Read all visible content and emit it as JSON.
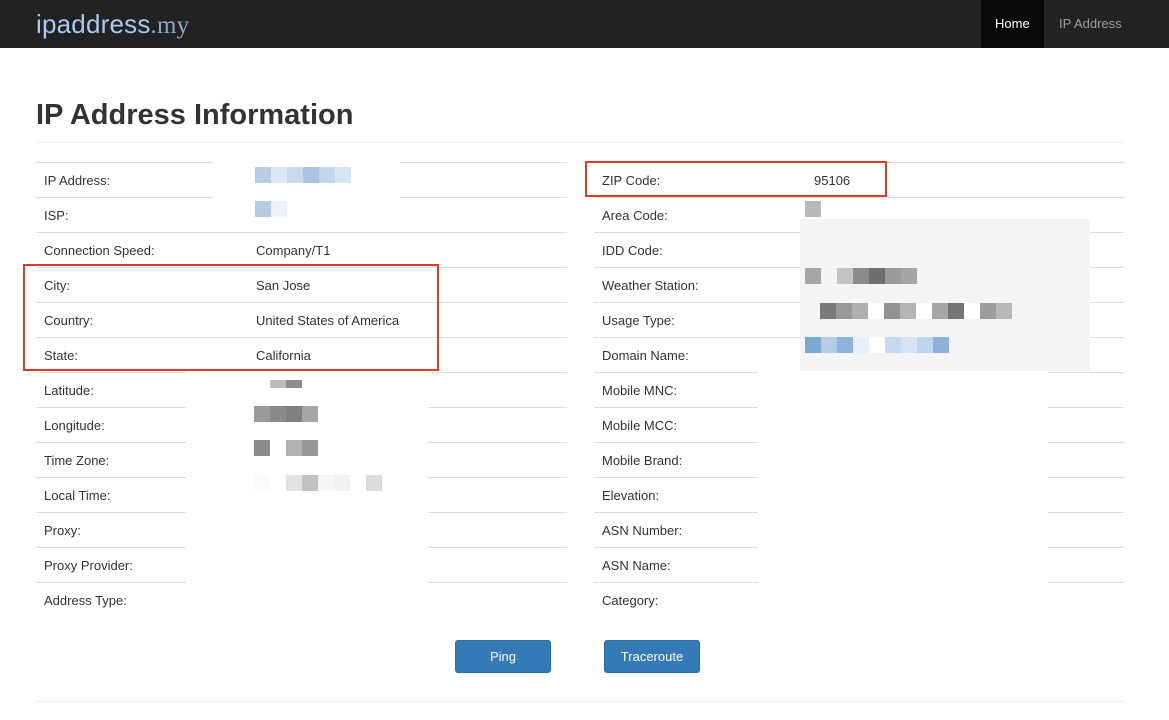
{
  "navbar": {
    "brand_name": "ipaddress",
    "brand_tld": ".my",
    "items": [
      {
        "label": "Home",
        "active": true
      },
      {
        "label": "IP Address",
        "active": false
      }
    ]
  },
  "page": {
    "title": "IP Address Information"
  },
  "left_table": [
    {
      "label": "IP Address:",
      "value": ""
    },
    {
      "label": "ISP:",
      "value": ""
    },
    {
      "label": "Connection Speed:",
      "value": "Company/T1"
    },
    {
      "label": "City:",
      "value": "San Jose"
    },
    {
      "label": "Country:",
      "value": "United States of America"
    },
    {
      "label": "State:",
      "value": "California"
    },
    {
      "label": "Latitude:",
      "value": ""
    },
    {
      "label": "Longitude:",
      "value": ""
    },
    {
      "label": "Time Zone:",
      "value": ""
    },
    {
      "label": "Local Time:",
      "value": ""
    },
    {
      "label": "Proxy:",
      "value": ""
    },
    {
      "label": "Proxy Provider:",
      "value": ""
    },
    {
      "label": "Address Type:",
      "value": ""
    }
  ],
  "right_table": [
    {
      "label": "ZIP Code:",
      "value": "95106"
    },
    {
      "label": "Area Code:",
      "value": ""
    },
    {
      "label": "IDD Code:",
      "value": ""
    },
    {
      "label": "Weather Station:",
      "value": ""
    },
    {
      "label": "Usage Type:",
      "value": ""
    },
    {
      "label": "Domain Name:",
      "value": ""
    },
    {
      "label": "Mobile MNC:",
      "value": ""
    },
    {
      "label": "Mobile MCC:",
      "value": ""
    },
    {
      "label": "Mobile Brand:",
      "value": ""
    },
    {
      "label": "Elevation:",
      "value": ""
    },
    {
      "label": "ASN Number:",
      "value": ""
    },
    {
      "label": "ASN Name:",
      "value": ""
    },
    {
      "label": "Category:",
      "value": ""
    }
  ],
  "buttons": {
    "ping": "Ping",
    "traceroute": "Traceroute"
  },
  "colors": {
    "navbar_bg": "#222222",
    "brand": "#a9c9f2",
    "button_primary": "#337ab7",
    "highlight_box": "#e03a22"
  }
}
